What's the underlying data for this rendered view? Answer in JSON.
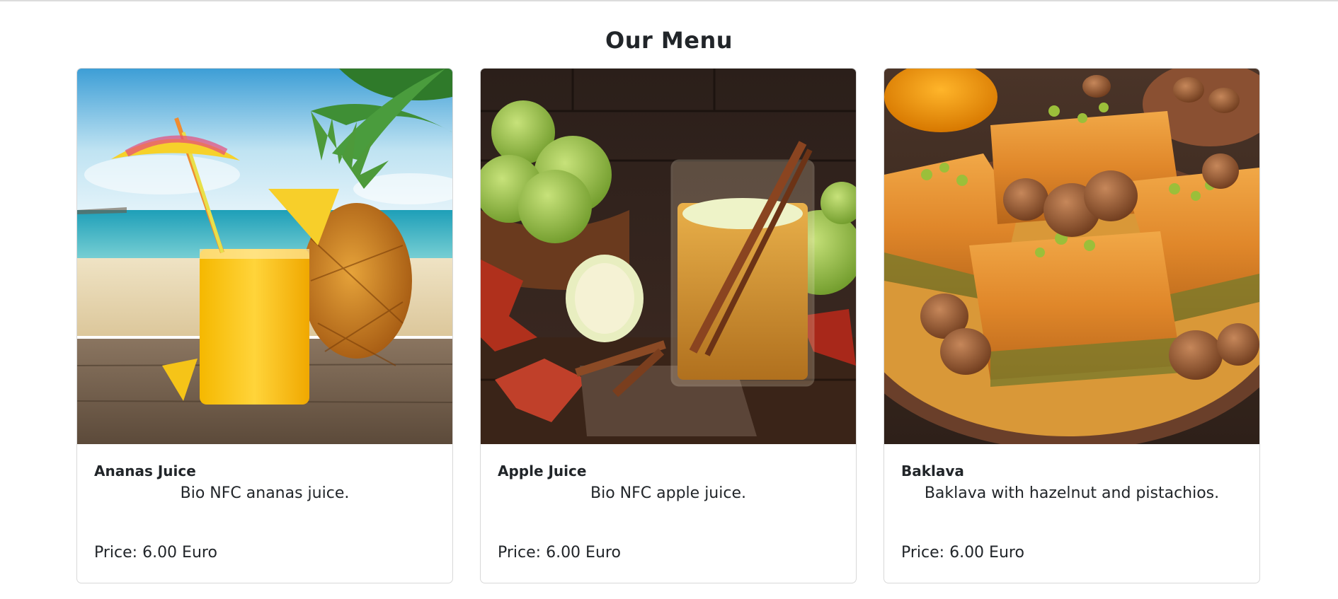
{
  "page": {
    "title": "Our Menu"
  },
  "menu_items": [
    {
      "image_subject": "pineapple-juice-beach-image",
      "name": "Ananas Juice",
      "description": "Bio NFC ananas juice.",
      "price_text": "Price: 6.00 Euro"
    },
    {
      "image_subject": "apple-juice-cinnamon-image",
      "name": "Apple Juice",
      "description": "Bio NFC apple juice.",
      "price_text": "Price: 6.00 Euro"
    },
    {
      "image_subject": "baklava-hazelnut-image",
      "name": "Baklava",
      "description": "Baklava with hazelnut and pistachios.",
      "price_text": "Price: 6.00 Euro"
    }
  ],
  "colors": {
    "text": "#212529",
    "card_border": "#d8d8d8",
    "background": "#ffffff"
  }
}
